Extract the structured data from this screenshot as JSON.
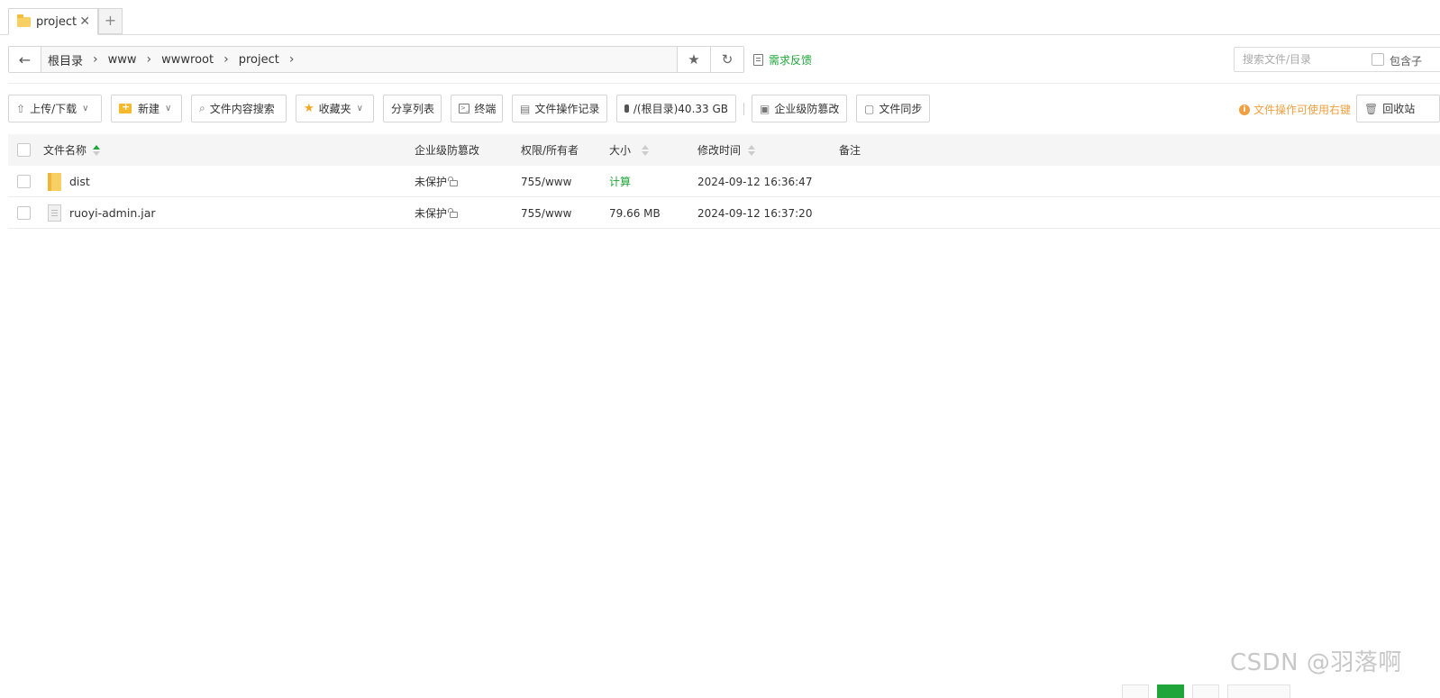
{
  "tabs": [
    {
      "label": "project",
      "close": "✕"
    }
  ],
  "tab_add": "+",
  "address": {
    "crumbs": [
      "根目录",
      "www",
      "wwwroot",
      "project"
    ],
    "sep": "›"
  },
  "feedback": "需求反馈",
  "search": {
    "placeholder": "搜索文件/目录",
    "subdir_label": "包含子"
  },
  "toolbar": {
    "upload": "上传/下载",
    "new": "新建",
    "content_search": "文件内容搜索",
    "favorites": "收藏夹",
    "share_list": "分享列表",
    "terminal": "终端",
    "op_log": "文件操作记录",
    "disk": "/(根目录)40.33 GB",
    "tamper": "企业级防篡改",
    "sync": "文件同步",
    "hint": "文件操作可使用右键",
    "recycle": "回收站"
  },
  "table": {
    "headers": {
      "name": "文件名称",
      "tamper": "企业级防篡改",
      "perm": "权限/所有者",
      "size": "大小",
      "mtime": "修改时间",
      "note": "备注"
    },
    "rows": [
      {
        "name": "dist",
        "type": "folder",
        "tamper": "未保护",
        "perm": "755/www",
        "size": "计算",
        "mtime": "2024-09-12 16:36:47",
        "note": ""
      },
      {
        "name": "ruoyi-admin.jar",
        "type": "file",
        "tamper": "未保护",
        "perm": "755/www",
        "size": "79.66 MB",
        "mtime": "2024-09-12 16:37:20",
        "note": ""
      }
    ]
  },
  "watermark": "CSDN @羽落啊",
  "colors": {
    "accent": "#20a53a",
    "hint": "#f0a040",
    "folder": "#f7cf62"
  }
}
